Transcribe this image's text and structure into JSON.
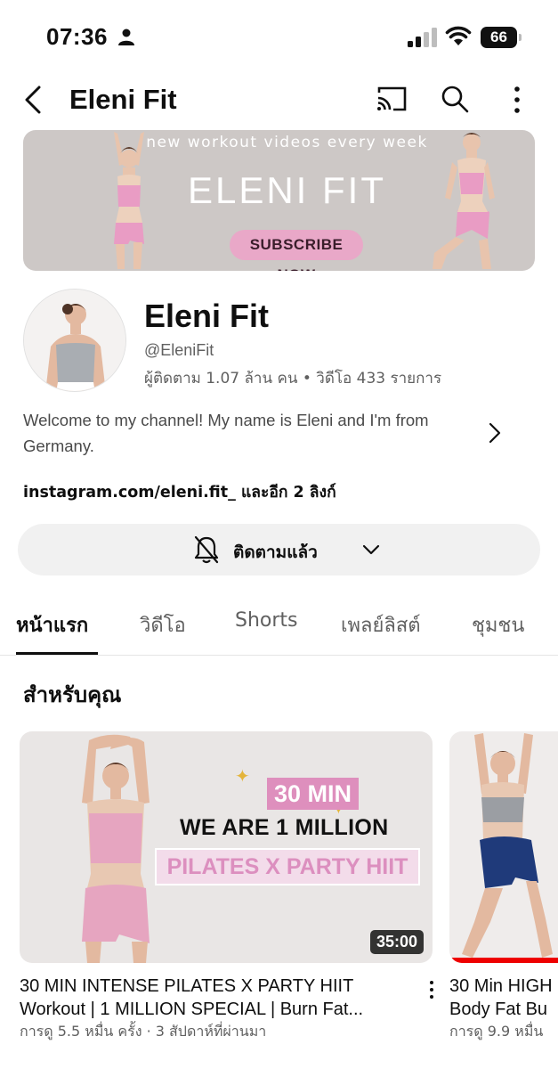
{
  "status_bar": {
    "time": "07:36",
    "battery": "66"
  },
  "header": {
    "title": "Eleni Fit",
    "icons": [
      "back-icon",
      "cast-icon",
      "search-icon",
      "more-icon"
    ]
  },
  "banner": {
    "tagline": "new workout videos every week",
    "brand": "ELENI FIT",
    "cta": "SUBSCRIBE NOW"
  },
  "channel": {
    "name": "Eleni Fit",
    "handle": "@EleniFit",
    "stats": "ผู้ติดตาม 1.07 ล้าน คน • วิดีโอ 433 รายการ",
    "description": "Welcome to my channel! My name is Eleni and I'm from Germany.",
    "links": "instagram.com/eleni.fit_ และอีก 2 ลิงก์"
  },
  "subscribe": {
    "label": "ติดตามแล้ว"
  },
  "tabs": [
    {
      "label": "หน้าแรก",
      "active": true
    },
    {
      "label": "วิดีโอ",
      "active": false
    },
    {
      "label": "Shorts",
      "active": false
    },
    {
      "label": "เพลย์ลิสต์",
      "active": false
    },
    {
      "label": "ชุมชน",
      "active": false
    }
  ],
  "section": {
    "title": "สำหรับคุณ"
  },
  "videos": [
    {
      "thumb_badge": "30 MIN",
      "thumb_line1": "WE ARE 1 MILLION",
      "thumb_line2": "PILATES X PARTY HIIT",
      "duration": "35:00",
      "title": "30 MIN INTENSE PILATES X PARTY HIIT Workout | 1 MILLION SPECIAL | Burn Fat...",
      "meta": "การดู 5.5 หมื่น ครั้ง · 3 สัปดาห์ที่ผ่านมา"
    },
    {
      "title": "30 Min HIGH",
      "title_line2": "Body Fat Bu",
      "meta": "การดู 9.9 หมื่น",
      "watch_progress": 1.0
    }
  ],
  "colors": {
    "accent_pink": "#de8fbd",
    "progress_red": "#ee0000",
    "banner_bg": "#cdc8c6"
  }
}
